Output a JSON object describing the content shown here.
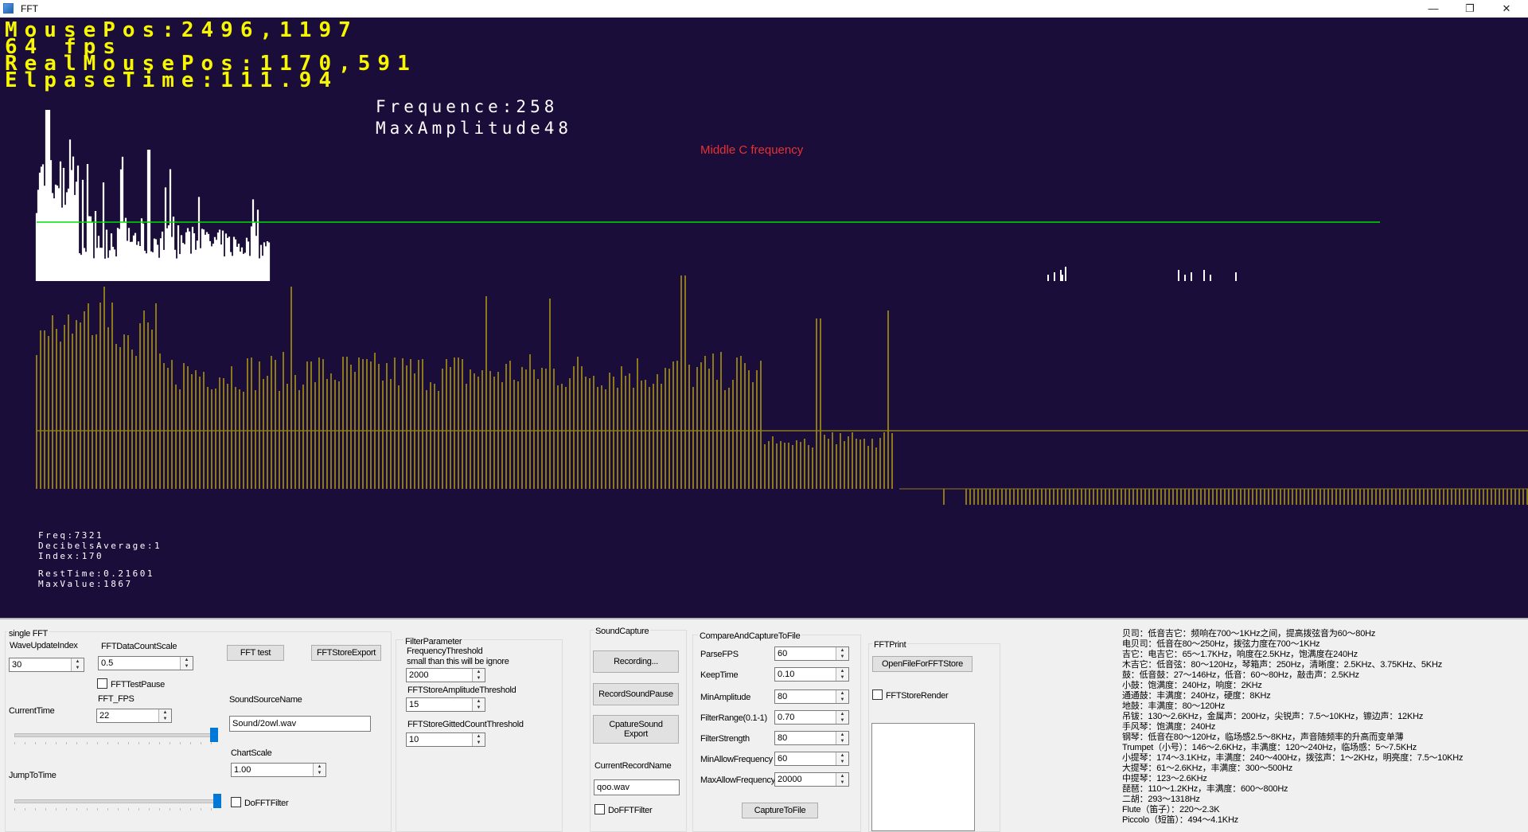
{
  "window": {
    "title": "FFT",
    "minimize": "—",
    "restore": "❐",
    "close": "✕"
  },
  "hud": {
    "mouse_pos": "MousePos:2496,1197",
    "fps": "64 fps",
    "real_mouse_pos": "RealMousePos:1170,591",
    "elapse_time": "ElpaseTime:111.94",
    "frequence": "Frequence:258",
    "max_amplitude": "MaxAmplitude48",
    "middle_c_label": "Middle C frequency"
  },
  "stats": {
    "freq": "Freq:7321",
    "decibels_average": "DecibelsAverage:1",
    "index": "Index:170",
    "rest_time": "RestTime:0.21601",
    "max_value": "MaxValue:1867"
  },
  "colors": {
    "background": "#1b0d3a",
    "spectrum": "#ffffff",
    "threshold_line": "#00e000",
    "bars": "#8c7a1a",
    "bar_line": "#8c7a1a",
    "hud_text": "#f7f700",
    "note_text": "#e63232",
    "slider": "#0078d7"
  },
  "panel": {
    "single_fft": {
      "title": "single FFT",
      "wave_update_index_label": "WaveUpdateIndex",
      "wave_update_index_value": "30",
      "fft_data_count_scale_label": "FFTDataCountScale",
      "fft_data_count_scale_value": "0.5",
      "fft_test_pause_label": "FFTTestPause",
      "fft_fps_label": "FFT_FPS",
      "fft_fps_value": "22",
      "current_time_label": "CurrentTime",
      "jump_to_time_label": "JumpToTime",
      "fft_test_button": "FFT test",
      "fft_store_export_button": "FFTStoreExport",
      "sound_source_name_label": "SoundSourceName",
      "sound_source_name_value": "Sound/2owl.wav",
      "chart_scale_label": "ChartScale",
      "chart_scale_value": "1.00",
      "do_fft_filter_label": "DoFFTFilter"
    },
    "filter_parameter": {
      "title": "FilterParameter",
      "frequency_threshold_label": "FrequencyThreshold",
      "frequency_threshold_hint": "small than this will be ignore",
      "frequency_threshold_value": "2000",
      "amplitude_threshold_label": "FFTStoreAmplitudeThreshold",
      "amplitude_threshold_value": "15",
      "gitted_count_threshold_label": "FFTStoreGittedCountThreshold",
      "gitted_count_threshold_value": "10"
    },
    "sound_capture": {
      "title": "SoundCapture",
      "recording_button": "Recording...",
      "record_sound_pause_button": "RecordSoundPause",
      "capture_sound_export_button": "CpatureSound Export",
      "current_record_name_label": "CurrentRecordName",
      "current_record_name_value": "qoo.wav",
      "do_fft_filter_label": "DoFFTFilter"
    },
    "compare_capture": {
      "title": "CompareAndCaptureToFile",
      "fields": [
        {
          "label": "ParseFPS",
          "value": "60"
        },
        {
          "label": "KeepTime",
          "value": "0.10"
        },
        {
          "label": "MinAmplitude",
          "value": "80"
        },
        {
          "label": "FilterRange(0.1-1)",
          "value": "0.70"
        },
        {
          "label": "FilterStrength",
          "value": "80"
        },
        {
          "label": "MinAllowFrequency",
          "value": "60"
        },
        {
          "label": "MaxAllowFrequency",
          "value": "20000"
        }
      ],
      "capture_button": "CaptureToFile"
    },
    "fft_print": {
      "title": "FFTPrint",
      "open_file_button": "OpenFileForFFTStore",
      "store_render_label": "FFTStoreRender"
    },
    "instrument_info": [
      "贝司：低音吉它：频响在700～1KHz之间，提高拨弦音为60～80Hz",
      "电贝司：低音在80～250Hz，拨弦力度在700～1KHz",
      "吉它：电吉它：65～1.7KHz，响度在2.5KHz，饱满度在240Hz",
      "木吉它：低音弦：80～120Hz，琴箱声：250Hz，清晰度：2.5KHz、3.75KHz、5KHz",
      "鼓：低音鼓：27～146Hz，低音：60～80Hz，敲击声：2.5KHz",
      "小鼓：饱满度：240Hz，响度：2KHz",
      "通通鼓：丰满度：240Hz，硬度：8KHz",
      "地鼓：丰满度：80～120Hz",
      "吊钹：130～2.6KHz，金属声：200Hz，尖锐声：7.5～10KHz，镲边声：12KHz",
      "手风琴：饱满度：240Hz",
      "钢琴：低音在80～120Hz，临场感2.5～8KHz，声音随频率的升高而变单薄",
      "Trumpet（小号）：146～2.6KHz，丰满度：120～240Hz，临场感：5～7.5KHz",
      "小提琴：174～3.1KHz，丰满度：240～400Hz，拨弦声：1～2KHz，明亮度：7.5～10KHz",
      "大提琴：61～2.6KHz，丰满度：300～500Hz",
      "中提琴：123～2.6KHz",
      "琵琶：110～1.2KHz，丰满度：600～800Hz",
      "二胡：293～1318Hz",
      "Flute（笛子）：220～2.3K",
      "Piccolo（短笛）：494～4.1KHz"
    ]
  }
}
